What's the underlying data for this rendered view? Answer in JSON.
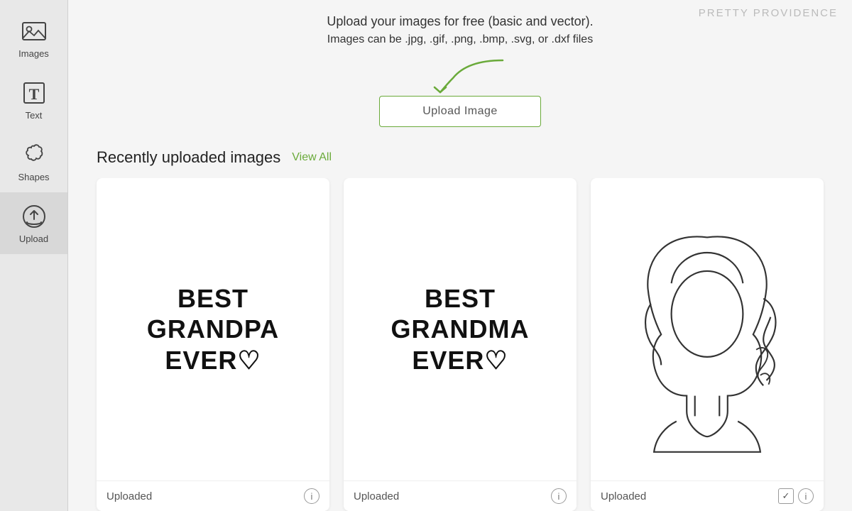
{
  "brand": "PRETTY PROVIDENCE",
  "headline": "Upload your images for free (basic and vector).",
  "subtext": "Images can be .jpg, .gif, .png, .bmp, .svg, or .dxf files",
  "upload_button_label": "Upload Image",
  "section_title": "Recently uploaded images",
  "view_all_label": "View All",
  "sidebar": {
    "items": [
      {
        "id": "images",
        "label": "Images"
      },
      {
        "id": "text",
        "label": "Text"
      },
      {
        "id": "shapes",
        "label": "Shapes"
      },
      {
        "id": "upload",
        "label": "Upload"
      }
    ]
  },
  "cards": [
    {
      "id": "card-grandpa",
      "text_line1": "BEST",
      "text_line2": "GRANDPA",
      "text_line3": "EVER♡",
      "status": "Uploaded",
      "has_check": false
    },
    {
      "id": "card-grandma",
      "text_line1": "BEST",
      "text_line2": "GRANDMA",
      "text_line3": "EVER♡",
      "status": "Uploaded",
      "has_check": false
    },
    {
      "id": "card-girl",
      "status": "Uploaded",
      "has_check": true
    }
  ],
  "colors": {
    "green_accent": "#6aaa3a",
    "sidebar_bg": "#e8e8e8",
    "card_bg": "#ffffff"
  }
}
